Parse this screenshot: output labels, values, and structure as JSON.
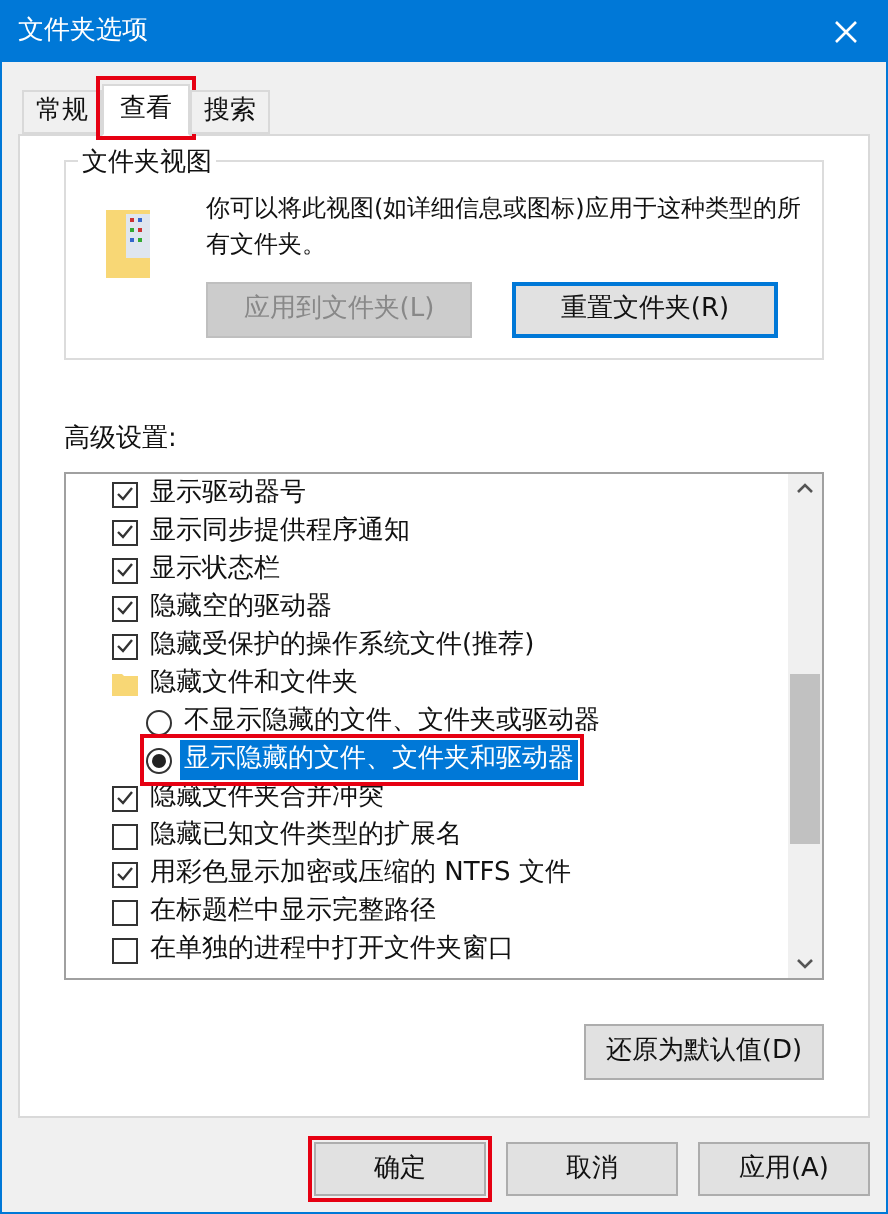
{
  "window": {
    "title": "文件夹选项"
  },
  "tabs": [
    {
      "label": "常规",
      "selected": false,
      "annotated": false
    },
    {
      "label": "查看",
      "selected": true,
      "annotated": true
    },
    {
      "label": "搜索",
      "selected": false,
      "annotated": false
    }
  ],
  "folder_views": {
    "title": "文件夹视图",
    "description": "你可以将此视图(如详细信息或图标)应用于这种类型的所有文件夹。",
    "buttons": [
      {
        "label": "应用到文件夹(L)",
        "disabled": true,
        "focused": false
      },
      {
        "label": "重置文件夹(R)",
        "disabled": false,
        "focused": true
      }
    ]
  },
  "advanced": {
    "label": "高级设置:",
    "items": [
      {
        "kind": "checkbox",
        "label": "显示驱动器号",
        "checked": true
      },
      {
        "kind": "checkbox",
        "label": "显示同步提供程序通知",
        "checked": true
      },
      {
        "kind": "checkbox",
        "label": "显示状态栏",
        "checked": true
      },
      {
        "kind": "checkbox",
        "label": "隐藏空的驱动器",
        "checked": true
      },
      {
        "kind": "checkbox",
        "label": "隐藏受保护的操作系统文件(推荐)",
        "checked": true
      },
      {
        "kind": "folder",
        "label": "隐藏文件和文件夹",
        "children": [
          {
            "kind": "radio",
            "label": "不显示隐藏的文件、文件夹或驱动器",
            "selected": false,
            "focused": false,
            "annotated": false
          },
          {
            "kind": "radio",
            "label": "显示隐藏的文件、文件夹和驱动器",
            "selected": true,
            "focused": true,
            "annotated": true
          }
        ]
      },
      {
        "kind": "checkbox",
        "label": "隐藏文件夹合并冲突",
        "checked": true
      },
      {
        "kind": "checkbox",
        "label": "隐藏已知文件类型的扩展名",
        "checked": false
      },
      {
        "kind": "checkbox",
        "label": "用彩色显示加密或压缩的 NTFS 文件",
        "checked": true
      },
      {
        "kind": "checkbox",
        "label": "在标题栏中显示完整路径",
        "checked": false
      },
      {
        "kind": "checkbox",
        "label": "在单独的进程中打开文件夹窗口",
        "checked": false
      }
    ],
    "restore_button": "还原为默认值(D)"
  },
  "buttons": [
    {
      "label": "确定",
      "annotated": true
    },
    {
      "label": "取消",
      "annotated": false
    },
    {
      "label": "应用(A)",
      "annotated": false
    }
  ]
}
